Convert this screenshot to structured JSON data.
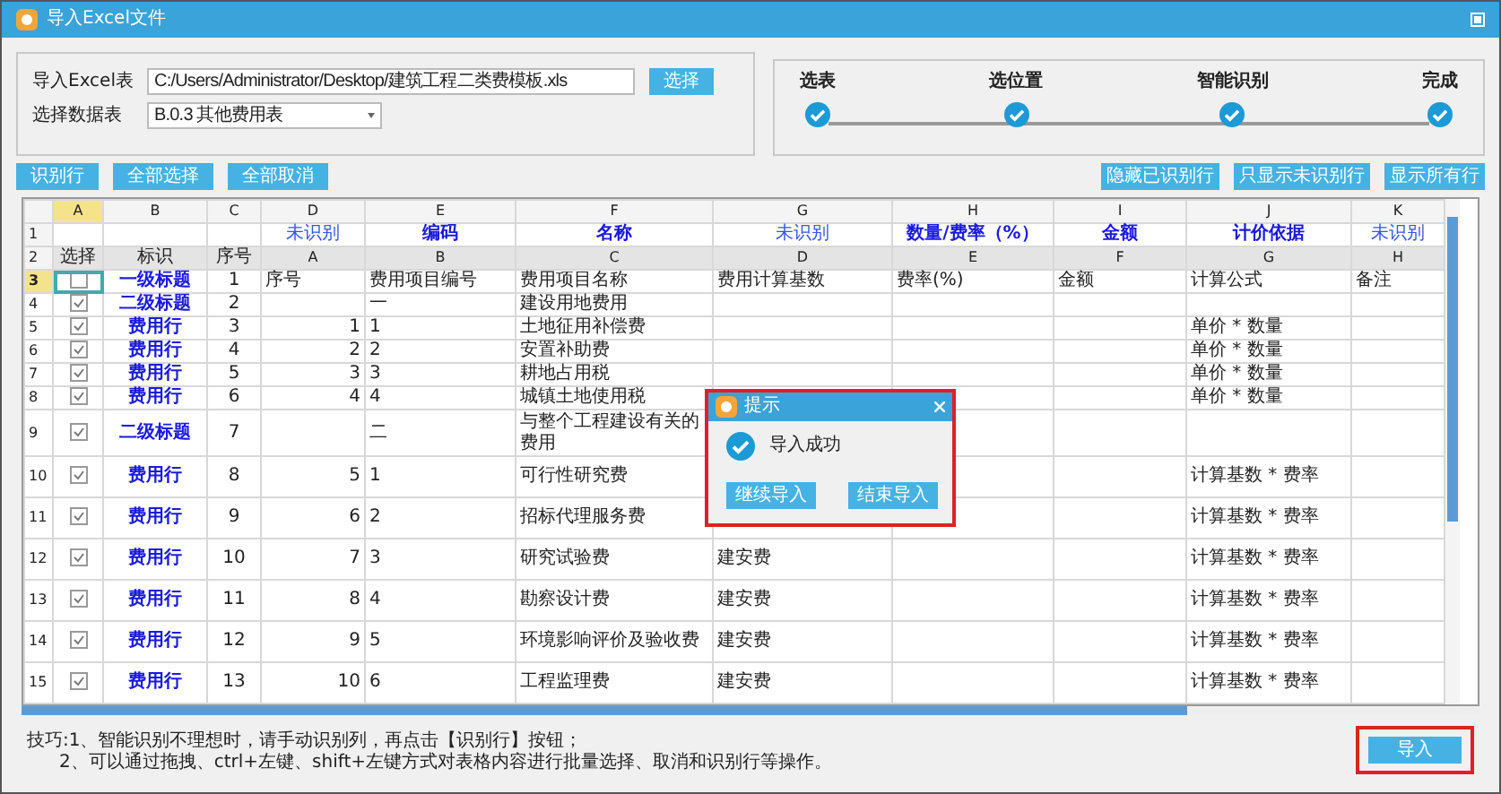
{
  "window": {
    "title": "导入Excel文件"
  },
  "file": {
    "label": "导入Excel表",
    "value": "C:/Users/Administrator/Desktop/建筑工程二类费模板.xls",
    "button": "选择"
  },
  "sheet": {
    "label": "选择数据表",
    "value": "B.0.3 其他费用表"
  },
  "steps": [
    {
      "label": "选表",
      "done": true
    },
    {
      "label": "选位置",
      "done": true
    },
    {
      "label": "智能识别",
      "done": true
    },
    {
      "label": "完成",
      "done": true
    }
  ],
  "left_buttons": [
    "识别行",
    "全部选择",
    "全部取消"
  ],
  "right_buttons": [
    "隐藏已识别行",
    "只显示未识别行",
    "显示所有行"
  ],
  "table": {
    "header_row_numbers": [
      "1",
      "2"
    ],
    "columns": [
      {
        "letter": "A",
        "selected": true,
        "header": "选择"
      },
      {
        "letter": "B",
        "selected": false,
        "header": "标识"
      },
      {
        "letter": "C",
        "selected": false,
        "header": "序号"
      },
      {
        "letter": "D",
        "selected": false,
        "mapping": "未识别",
        "recognized": false,
        "header": "A"
      },
      {
        "letter": "E",
        "selected": false,
        "mapping": "编码",
        "recognized": true,
        "header": "B"
      },
      {
        "letter": "F",
        "selected": false,
        "mapping": "名称",
        "recognized": true,
        "header": "C"
      },
      {
        "letter": "G",
        "selected": false,
        "mapping": "未识别",
        "recognized": false,
        "header": "D"
      },
      {
        "letter": "H",
        "selected": false,
        "mapping": "数量/费率（%）",
        "recognized": true,
        "header": "E"
      },
      {
        "letter": "I",
        "selected": false,
        "mapping": "金额",
        "recognized": true,
        "header": "F"
      },
      {
        "letter": "J",
        "selected": false,
        "mapping": "计价依据",
        "recognized": true,
        "header": "G"
      },
      {
        "letter": "K",
        "selected": false,
        "mapping": "未识别",
        "recognized": false,
        "header": "H"
      }
    ],
    "rows": [
      {
        "number": "3",
        "selected": true,
        "checked": false,
        "kind": "titles",
        "mark": "一级标题",
        "seq": "1",
        "cells": {
          "D": "序号",
          "E": "费用项目编号",
          "F": "费用项目名称",
          "G": "费用计算基数",
          "H": "费率(%)",
          "I": "金额",
          "J": "计算公式",
          "K": "备注"
        }
      },
      {
        "number": "4",
        "selected": false,
        "checked": true,
        "kind": "section",
        "mark": "二级标题",
        "seq": "2",
        "cells": {
          "E": "一",
          "F": "建设用地费用"
        }
      },
      {
        "number": "5",
        "selected": false,
        "checked": true,
        "kind": "fee",
        "mark": "费用行",
        "seq": "3",
        "cells": {
          "D": "1",
          "E": "1",
          "F": "土地征用补偿费",
          "J": "单价 * 数量"
        }
      },
      {
        "number": "6",
        "selected": false,
        "checked": true,
        "kind": "fee",
        "mark": "费用行",
        "seq": "4",
        "cells": {
          "D": "2",
          "E": "2",
          "F": "安置补助费",
          "J": "单价 * 数量"
        }
      },
      {
        "number": "7",
        "selected": false,
        "checked": true,
        "kind": "fee",
        "mark": "费用行",
        "seq": "5",
        "cells": {
          "D": "3",
          "E": "3",
          "F": "耕地占用税",
          "J": "单价 * 数量"
        }
      },
      {
        "number": "8",
        "selected": false,
        "checked": true,
        "kind": "fee",
        "mark": "费用行",
        "seq": "6",
        "cells": {
          "D": "4",
          "E": "4",
          "F": "城镇土地使用税",
          "J": "单价 * 数量"
        }
      },
      {
        "number": "9",
        "selected": false,
        "checked": true,
        "kind": "section",
        "mark": "二级标题",
        "seq": "7",
        "cells": {
          "E": "二",
          "F": "与整个工程建设有关的费用"
        }
      },
      {
        "number": "10",
        "selected": false,
        "checked": true,
        "kind": "fee",
        "mark": "费用行",
        "seq": "8",
        "cells": {
          "D": "5",
          "E": "1",
          "F": "可行性研究费",
          "J": "计算基数 * 费率"
        }
      },
      {
        "number": "11",
        "selected": false,
        "checked": true,
        "kind": "fee",
        "mark": "费用行",
        "seq": "9",
        "cells": {
          "D": "6",
          "E": "2",
          "F": "招标代理服务费",
          "J": "计算基数 * 费率"
        }
      },
      {
        "number": "12",
        "selected": false,
        "checked": true,
        "kind": "fee",
        "mark": "费用行",
        "seq": "10",
        "cells": {
          "D": "7",
          "E": "3",
          "F": "研究试验费",
          "G": "建安费",
          "J": "计算基数 * 费率"
        }
      },
      {
        "number": "13",
        "selected": false,
        "checked": true,
        "kind": "fee",
        "mark": "费用行",
        "seq": "11",
        "cells": {
          "D": "8",
          "E": "4",
          "F": "勘察设计费",
          "G": "建安费",
          "J": "计算基数 * 费率"
        }
      },
      {
        "number": "14",
        "selected": false,
        "checked": true,
        "kind": "fee",
        "mark": "费用行",
        "seq": "12",
        "cells": {
          "D": "9",
          "E": "5",
          "F": "环境影响评价及验收费",
          "G": "建安费",
          "J": "计算基数 * 费率"
        }
      },
      {
        "number": "15",
        "selected": false,
        "checked": true,
        "kind": "fee",
        "mark": "费用行",
        "seq": "13",
        "cells": {
          "D": "10",
          "E": "6",
          "F": "工程监理费",
          "G": "建安费",
          "J": "计算基数 * 费率"
        }
      }
    ]
  },
  "dialog": {
    "title": "提示",
    "message": "导入成功",
    "buttons": [
      "继续导入",
      "结束导入"
    ]
  },
  "tips": [
    "技巧:1、智能识别不理想时，请手动识别列，再点击【识别行】按钮；",
    "2、可以通过拖拽、ctrl+左键、shift+左键方式对表格内容进行批量选择、取消和识别行等操作。"
  ],
  "import_button": "导入"
}
